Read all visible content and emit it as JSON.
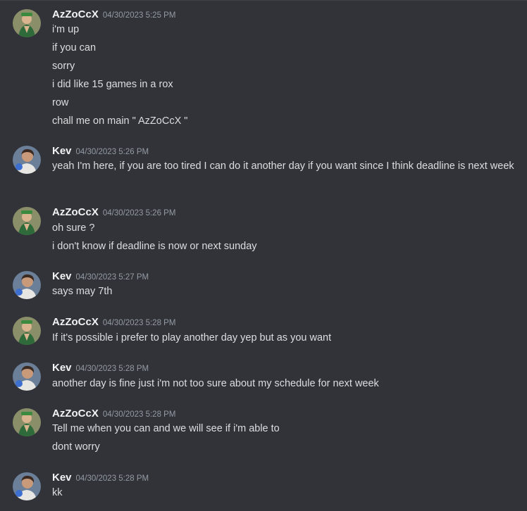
{
  "messages": [
    {
      "author": "AzZoCcX",
      "timestamp": "04/30/2023 5:25 PM",
      "avatar": "zoro-avatar",
      "lines": [
        "i'm up",
        "if you can",
        "sorry",
        "i did like 15 games in a rox",
        "row",
        "chall me on main \" AzZoCcX \""
      ]
    },
    {
      "author": "Kev",
      "timestamp": "04/30/2023 5:26 PM",
      "avatar": "kev-avatar",
      "lines": [
        "yeah I'm here, if you are too tired I can do it another day if you want since I think deadline is next week"
      ]
    },
    {
      "author": "AzZoCcX",
      "timestamp": "04/30/2023 5:26 PM",
      "avatar": "zoro-avatar",
      "lines": [
        "oh sure ?",
        "i don't know if deadline is now or next sunday"
      ]
    },
    {
      "author": "Kev",
      "timestamp": "04/30/2023 5:27 PM",
      "avatar": "kev-avatar",
      "lines": [
        "says may 7th"
      ]
    },
    {
      "author": "AzZoCcX",
      "timestamp": "04/30/2023 5:28 PM",
      "avatar": "zoro-avatar",
      "lines": [
        "If it's possible i prefer to play another day yep but as you want"
      ]
    },
    {
      "author": "Kev",
      "timestamp": "04/30/2023 5:28 PM",
      "avatar": "kev-avatar",
      "lines": [
        "another day is fine just i'm not too sure about my schedule for next week"
      ]
    },
    {
      "author": "AzZoCcX",
      "timestamp": "04/30/2023 5:28 PM",
      "avatar": "zoro-avatar",
      "lines": [
        "Tell me when you can and we will see if i'm able to",
        "dont worry"
      ]
    },
    {
      "author": "Kev",
      "timestamp": "04/30/2023 5:28 PM",
      "avatar": "kev-avatar",
      "lines": [
        "kk"
      ]
    }
  ],
  "colors": {
    "background": "#313338",
    "username": "#f2f3f5",
    "timestamp": "#949ba4",
    "message_text": "#dbdee1"
  }
}
